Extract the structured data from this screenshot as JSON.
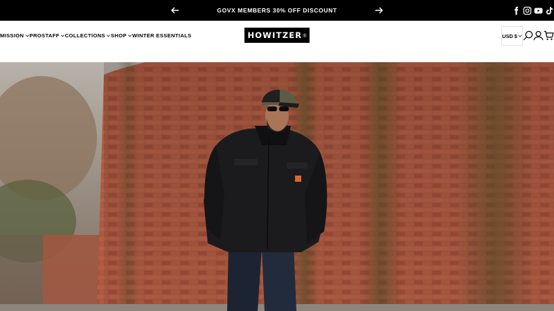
{
  "announcement": {
    "message": "GOVX MEMBERS 30% OFF DISCOUNT",
    "prev_icon": "arrow-left-icon",
    "next_icon": "arrow-right-icon"
  },
  "social": [
    "facebook-icon",
    "instagram-icon",
    "youtube-icon",
    "tiktok-icon"
  ],
  "nav": {
    "items": [
      {
        "label": "MISSION",
        "has_dropdown": true
      },
      {
        "label": "PROSTAFF",
        "has_dropdown": true
      },
      {
        "label": "COLLECTIONS",
        "has_dropdown": true
      },
      {
        "label": "SHOP",
        "has_dropdown": true
      },
      {
        "label": "WINTER ESSENTIALS",
        "has_dropdown": false
      }
    ]
  },
  "logo": {
    "text": "HOWITZER",
    "mark": "®"
  },
  "tools": {
    "currency": "USD $",
    "search_icon": "search-icon",
    "account_icon": "account-icon",
    "cart_icon": "cart-icon"
  },
  "colors": {
    "announcement_bg": "#000000",
    "header_bg": "#ffffff",
    "brick": "#a5523c"
  }
}
